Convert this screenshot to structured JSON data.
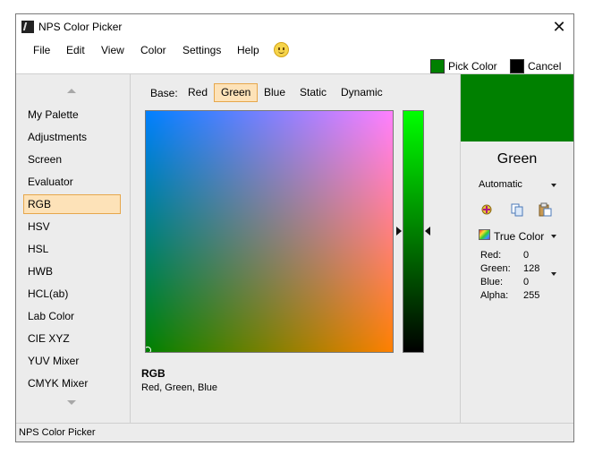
{
  "window": {
    "title": "NPS Color Picker"
  },
  "menu": {
    "items": [
      "File",
      "Edit",
      "View",
      "Color",
      "Settings",
      "Help"
    ]
  },
  "actions": {
    "pick": {
      "label": "Pick Color",
      "swatch": "#008000"
    },
    "cancel": {
      "label": "Cancel",
      "swatch": "#000000"
    }
  },
  "sidebar": {
    "items": [
      "My Palette",
      "Adjustments",
      "Screen",
      "Evaluator",
      "RGB",
      "HSV",
      "HSL",
      "HWB",
      "HCL(ab)",
      "Lab Color",
      "CIE XYZ",
      "YUV Mixer",
      "CMYK Mixer"
    ],
    "selected": "RGB"
  },
  "base": {
    "label": "Base:",
    "options": [
      "Red",
      "Green",
      "Blue",
      "Static",
      "Dynamic"
    ],
    "selected": "Green"
  },
  "model": {
    "name": "RGB",
    "description": "Red, Green, Blue"
  },
  "color": {
    "preview": "#008000",
    "name": "Green",
    "mode": "Automatic",
    "format": "True Color",
    "channels": [
      {
        "label": "Red:",
        "value": "0"
      },
      {
        "label": "Green:",
        "value": "128"
      },
      {
        "label": "Blue:",
        "value": "0"
      },
      {
        "label": "Alpha:",
        "value": "255"
      }
    ]
  },
  "status": {
    "text": "NPS Color Picker"
  }
}
